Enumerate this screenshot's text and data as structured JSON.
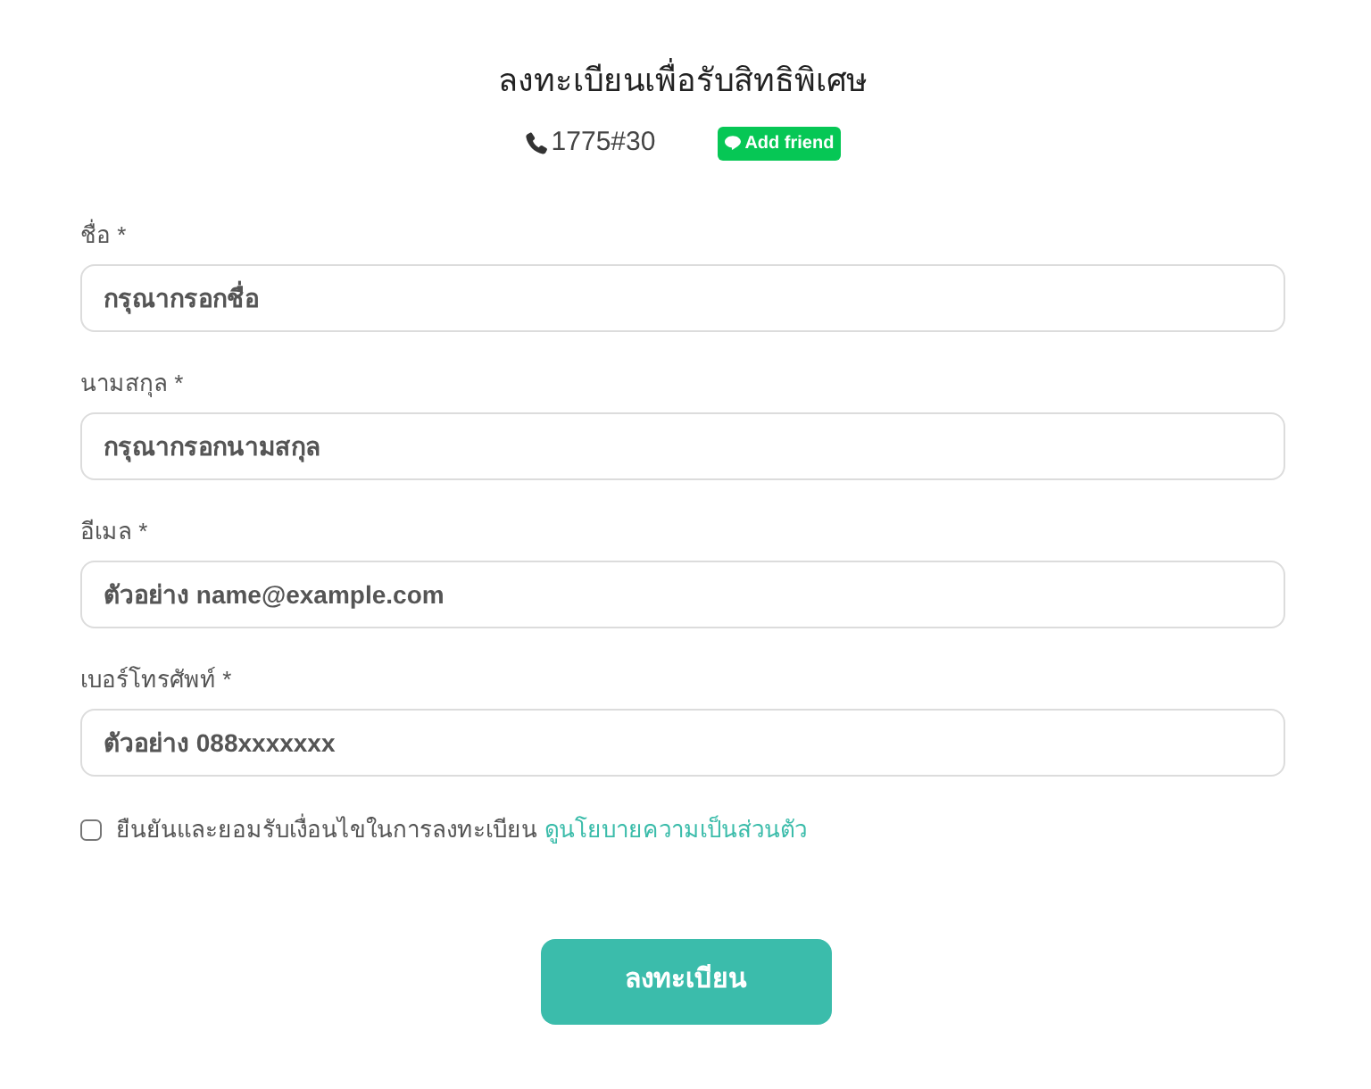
{
  "header": {
    "title": "ลงทะเบียนเพื่อรับสิทธิพิเศษ",
    "phone": "1775#30",
    "friend_button": "Add friend"
  },
  "fields": [
    {
      "label": "ชื่อ *",
      "placeholder": "กรุณากรอกชื่อ"
    },
    {
      "label": "นามสกุล *",
      "placeholder": "กรุณากรอกนามสกุล"
    },
    {
      "label": "อีเมล *",
      "placeholder": "ตัวอย่าง name@example.com"
    },
    {
      "label": "เบอร์โทรศัพท์ *",
      "placeholder": "ตัวอย่าง 088xxxxxxx"
    }
  ],
  "consent": {
    "checked": false,
    "text": "ยืนยันและยอมรับเงื่อนไขในการลงทะเบียน",
    "link": "ดูนโยบายความเป็นส่วนตัว"
  },
  "submit": "ลงทะเบียน"
}
